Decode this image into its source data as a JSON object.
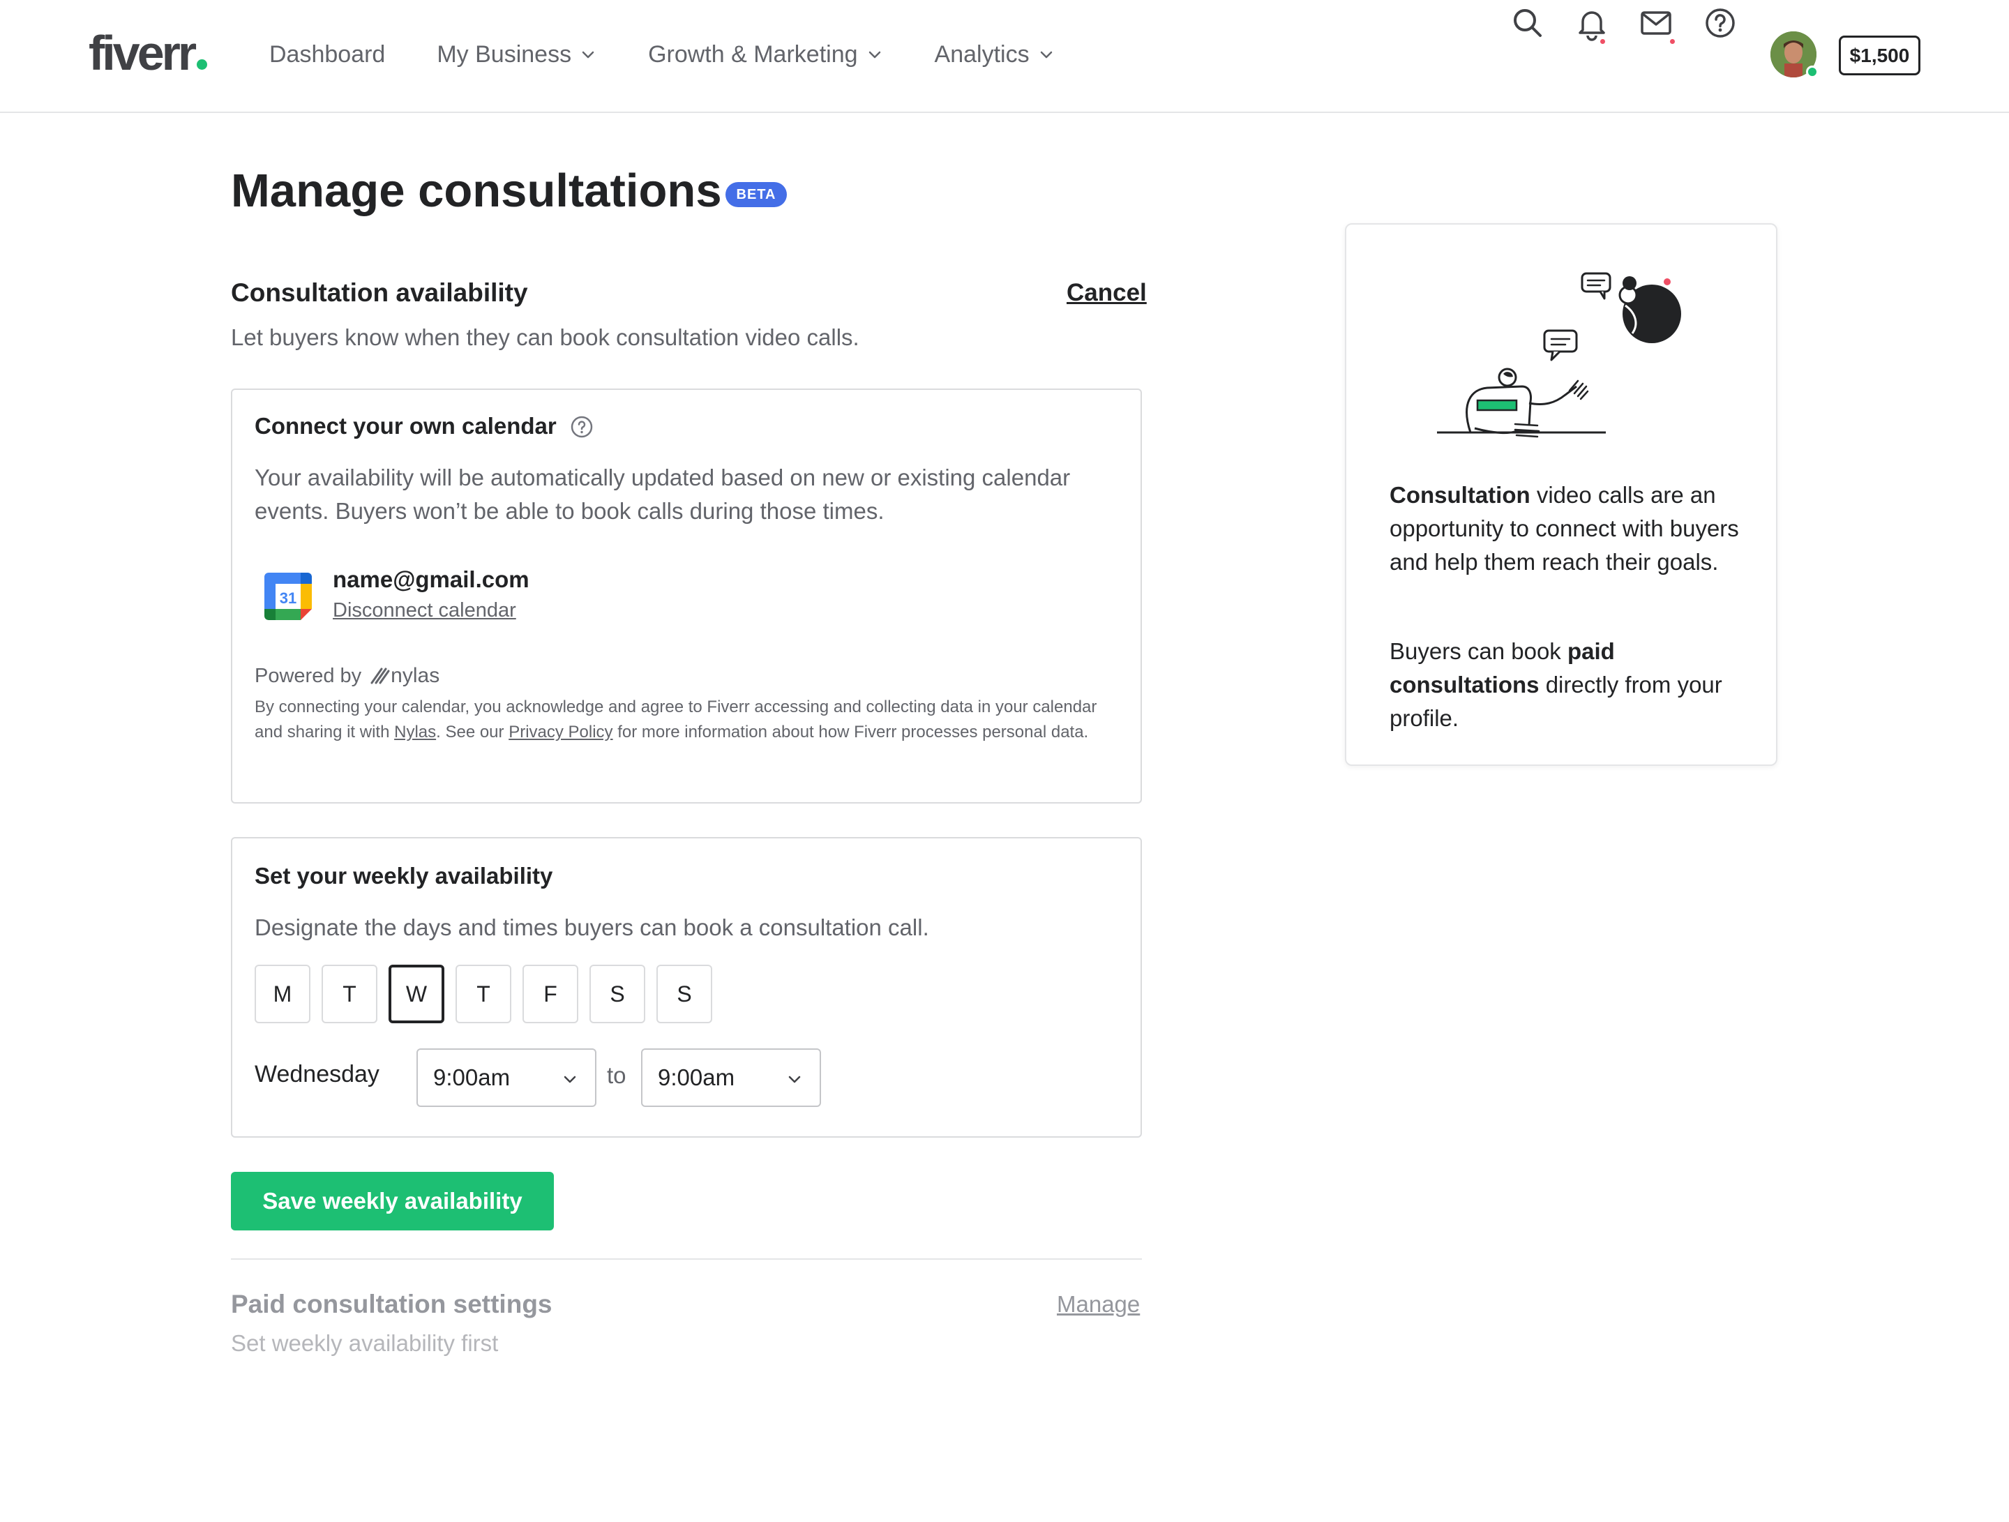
{
  "header": {
    "logo": "fiverr",
    "nav": [
      {
        "label": "Dashboard",
        "has_dropdown": false
      },
      {
        "label": "My Business",
        "has_dropdown": true
      },
      {
        "label": "Growth & Marketing",
        "has_dropdown": true
      },
      {
        "label": "Analytics",
        "has_dropdown": true
      }
    ],
    "icons": [
      "search-icon",
      "bell-icon",
      "mail-icon",
      "help-icon"
    ],
    "balance": "$1,500"
  },
  "page": {
    "title": "Manage consultations",
    "badge": "BETA"
  },
  "availability": {
    "title": "Consultation availability",
    "cancel_label": "Cancel",
    "subtitle": "Let buyers know when they can book consultation video calls."
  },
  "calendar_card": {
    "title": "Connect your own calendar",
    "description": "Your availability will be automatically updated based on new or existing calendar events. Buyers won’t be able to book calls during those times.",
    "calendar_day": "31",
    "email": "name@gmail.com",
    "disconnect_label": "Disconnect calendar",
    "powered_by": "Powered by",
    "nylas_brand": "nylas",
    "legal_prefix": "By connecting your calendar, you acknowledge and agree to Fiverr accessing and collecting data in your calendar and sharing it with ",
    "legal_link_nylas": "Nylas",
    "legal_middle": ". See our ",
    "legal_link_privacy": "Privacy Policy",
    "legal_suffix": " for more information about how Fiverr processes personal data."
  },
  "weekly_card": {
    "title": "Set your weekly availability",
    "description": "Designate the days and times buyers can book a consultation call.",
    "days": [
      "M",
      "T",
      "W",
      "T",
      "F",
      "S",
      "S"
    ],
    "selected_day_index": 2,
    "selected_day_name": "Wednesday",
    "from_time": "9:00am",
    "to_label": "to",
    "to_time": "9:00am"
  },
  "save_button": "Save weekly availability",
  "paid": {
    "title": "Paid consultation settings",
    "manage_label": "Manage",
    "subtitle": "Set weekly availability first"
  },
  "side_card": {
    "p1_bold": "Consultation",
    "p1_rest": " video calls are an opportunity to connect with buyers and help them reach their goals.",
    "p2_start": "Buyers can book ",
    "p2_bold": "paid consultations",
    "p2_end": " directly from your profile."
  },
  "colors": {
    "brand_green": "#1dbf73",
    "beta_blue": "#446ee7",
    "notification_red": "#ef4f65"
  }
}
